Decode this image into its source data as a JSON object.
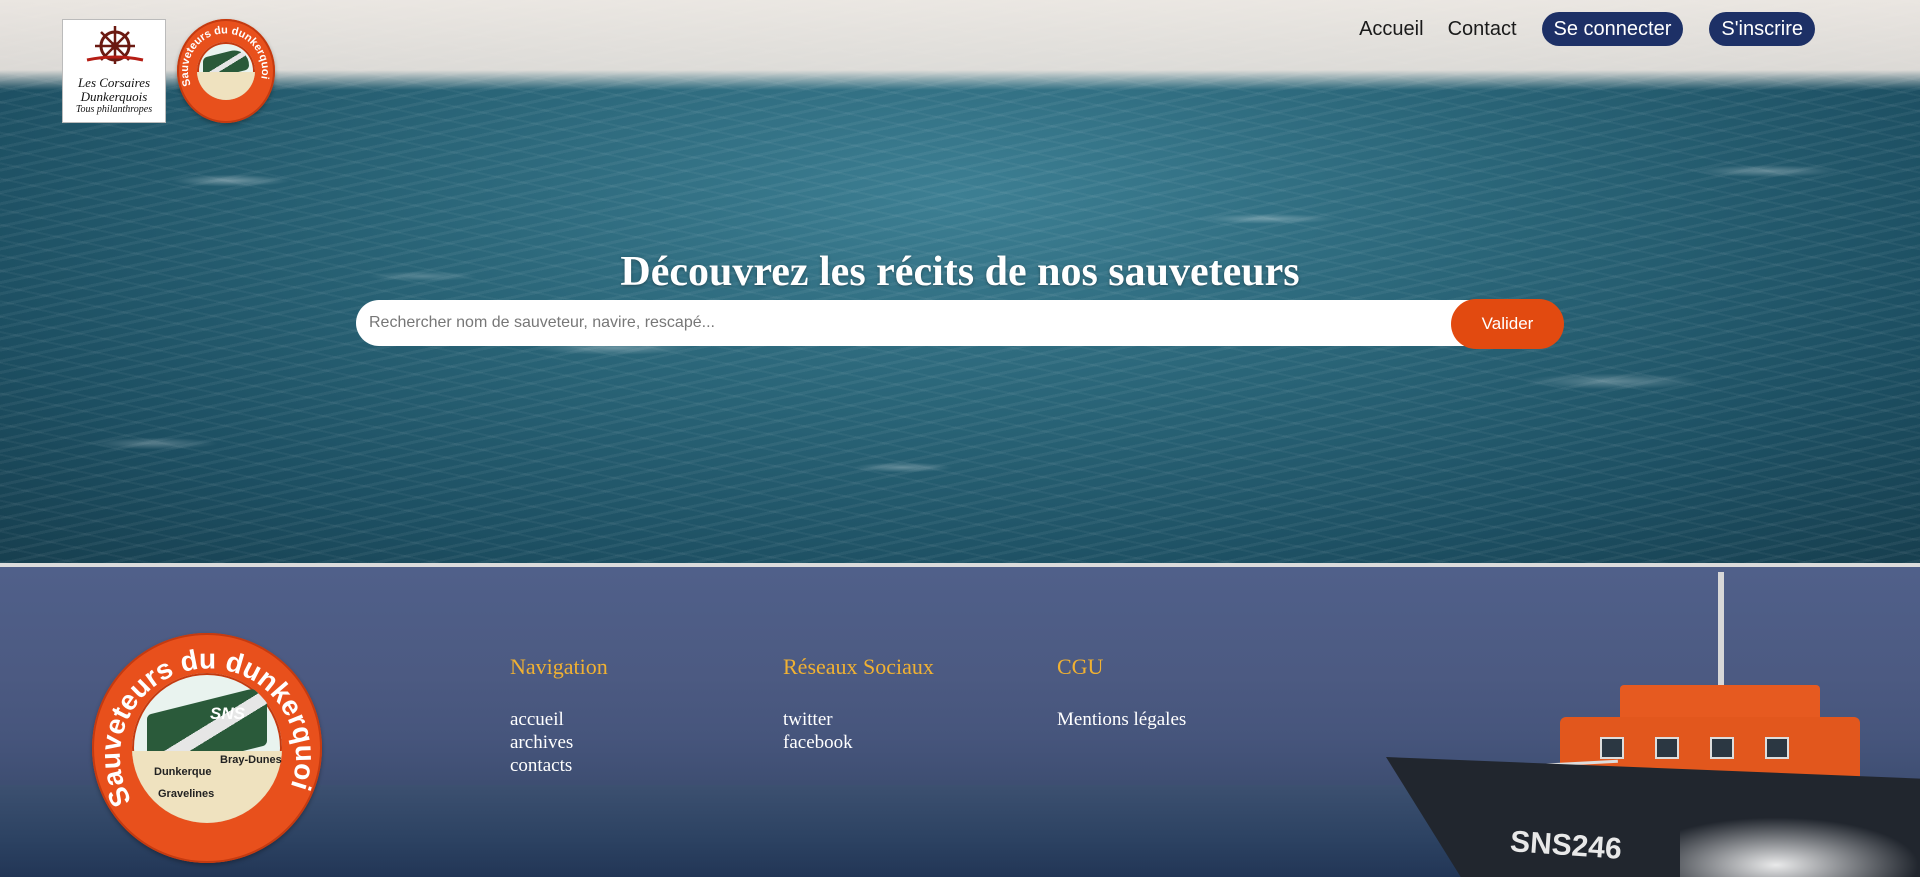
{
  "header": {
    "logo_left_text_line1": "Les Corsaires",
    "logo_left_text_line2": "Dunkerquois",
    "logo_left_tagline": "Tous philanthropes",
    "logo_right_ring_text": "Sauveteurs du dunkerquois",
    "nav": {
      "home": "Accueil",
      "contact": "Contact",
      "login": "Se connecter",
      "signup": "S'inscrire"
    }
  },
  "hero": {
    "title": "Découvrez les récits de nos sauveteurs",
    "search_placeholder": "Rechercher nom de sauveteur, navire, rescapé...",
    "search_button": "Valider"
  },
  "footer": {
    "logo_ring_text": "Sauveteurs du dunkerquois",
    "logo_places": [
      "SNS",
      "Dunkerque",
      "Bray-Dunes",
      "Gravelines"
    ],
    "columns": {
      "navigation": {
        "title": "Navigation",
        "links": [
          "accueil",
          "archives",
          "contacts"
        ]
      },
      "social": {
        "title": "Réseaux Sociaux",
        "links": [
          "twitter",
          "facebook"
        ]
      },
      "cgu": {
        "title": "CGU",
        "links": [
          "Mentions légales"
        ]
      }
    },
    "boat_label": "SNS246"
  },
  "colors": {
    "nav_pill": "#1d3066",
    "search_button": "#e24a10",
    "footer_heading": "#f0b132",
    "footer_bg": "#4c5a82"
  }
}
